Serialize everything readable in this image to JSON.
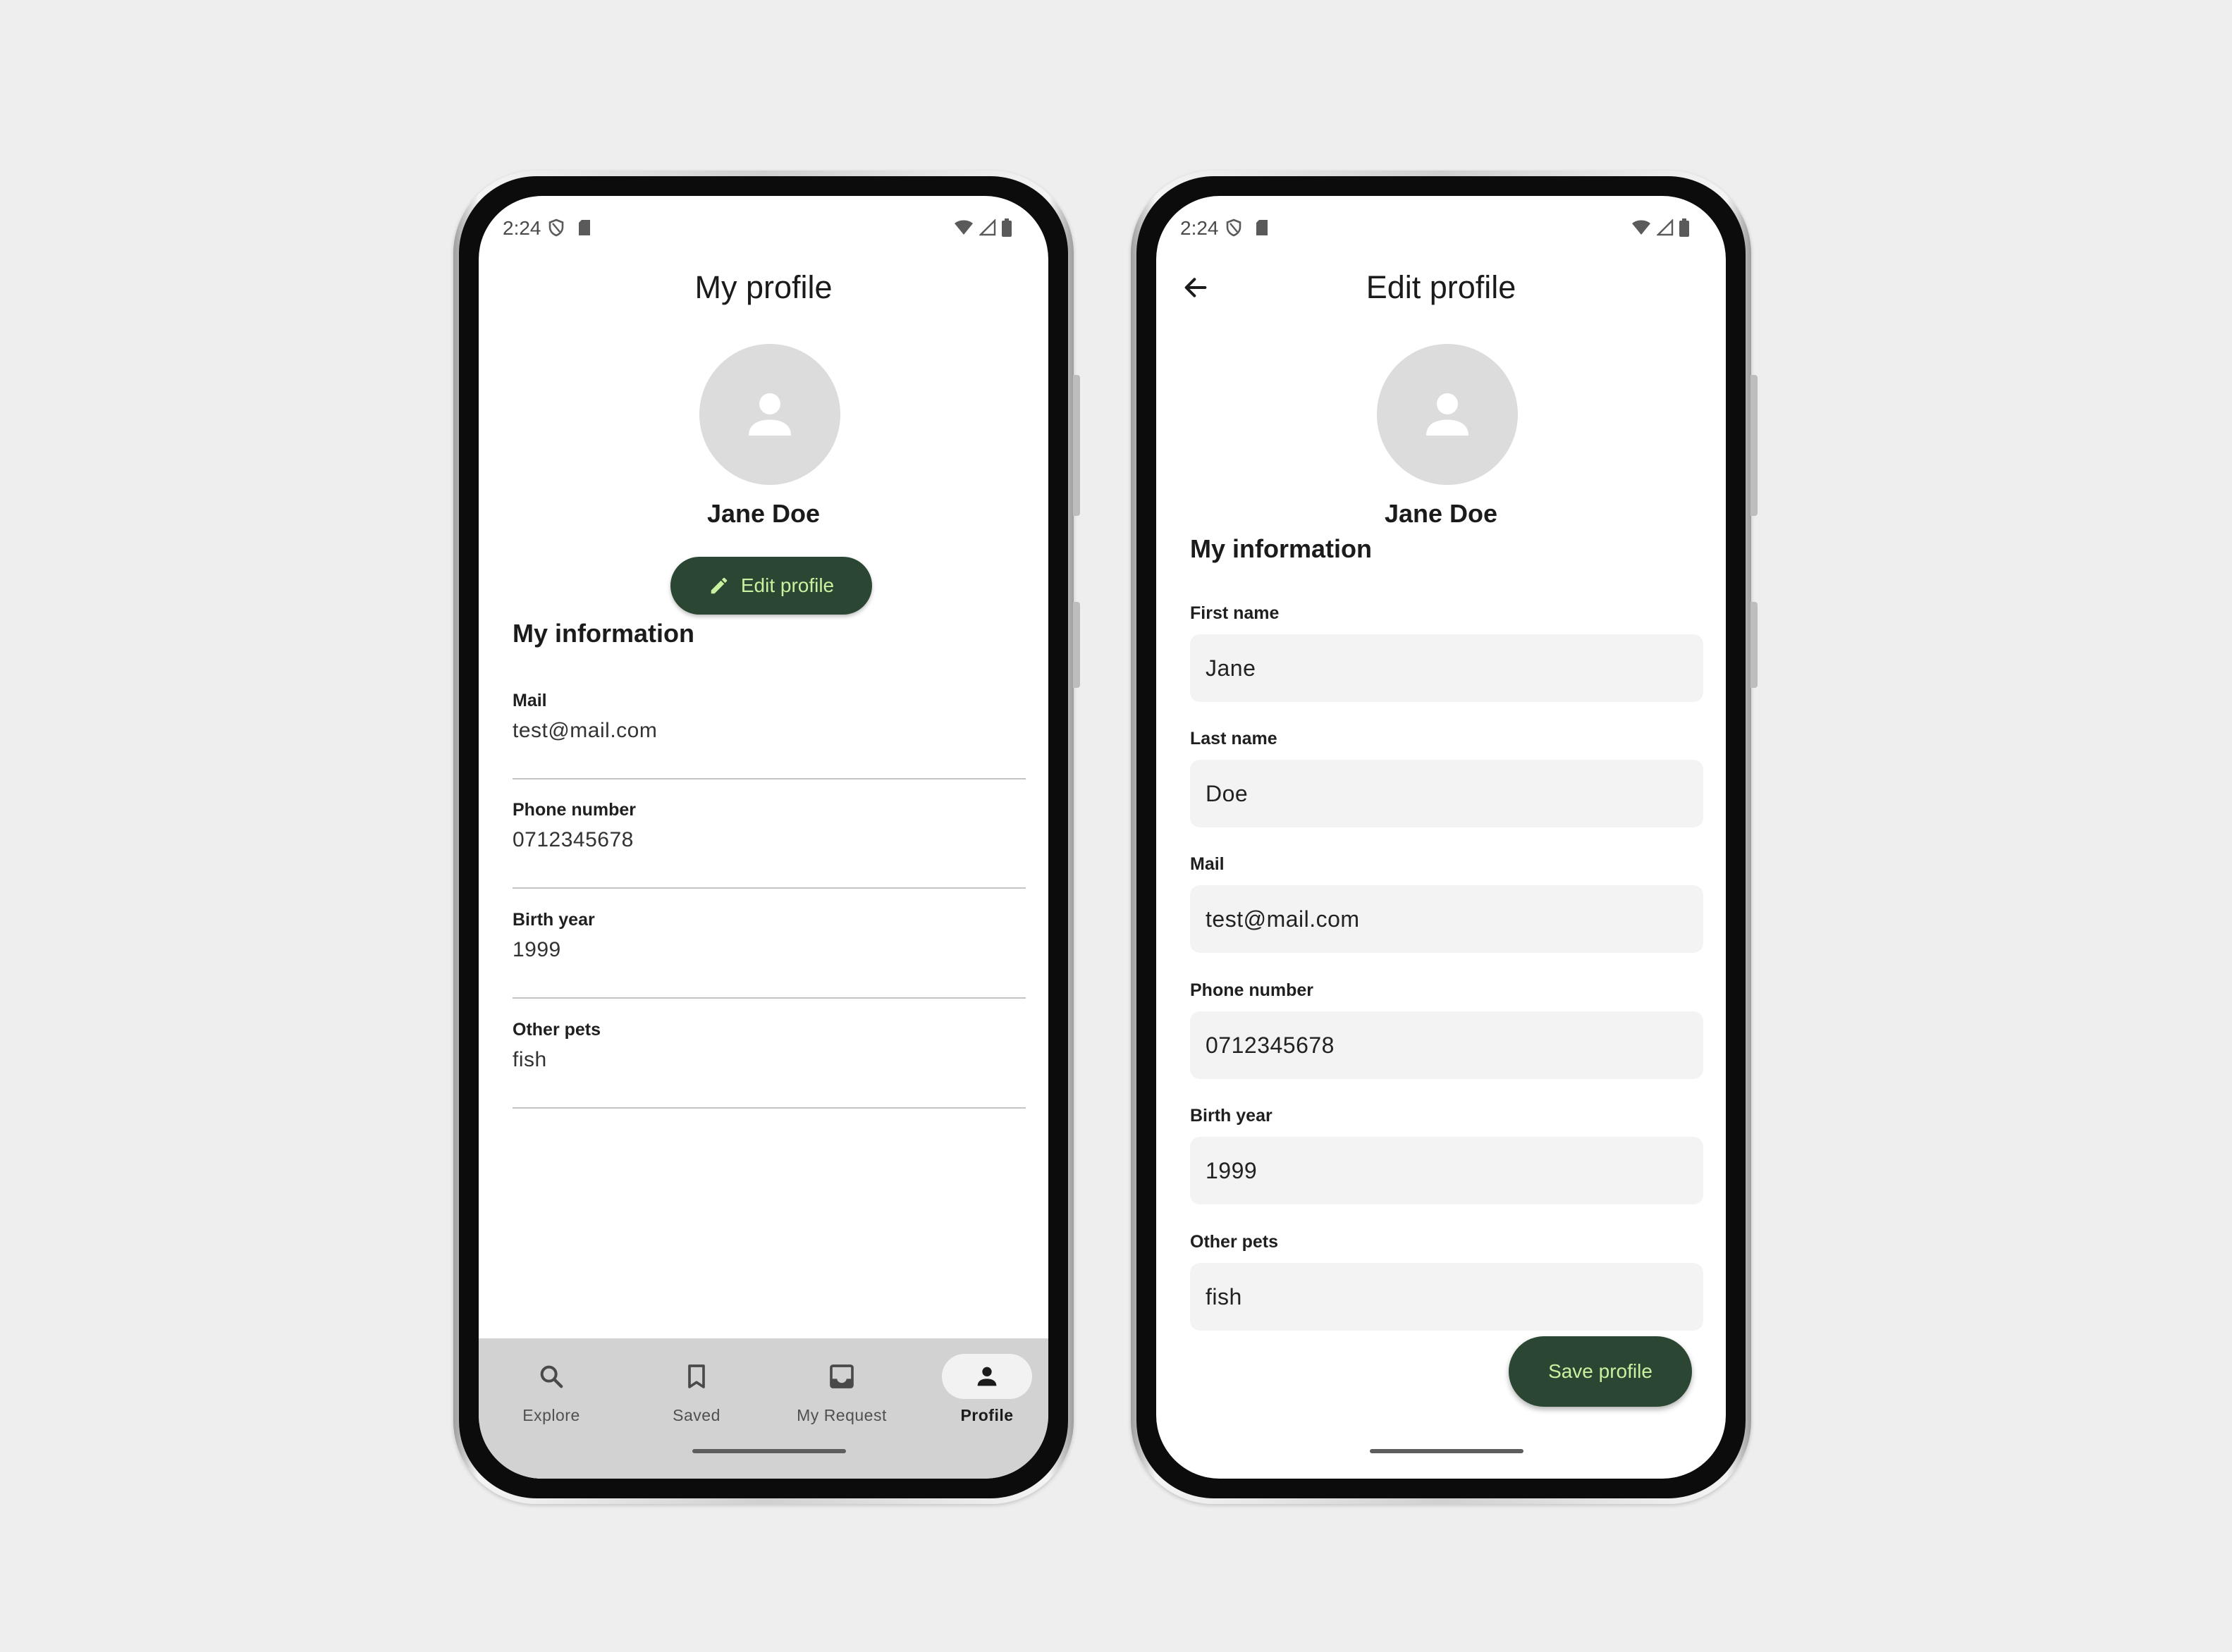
{
  "status_bar": {
    "time": "2:24"
  },
  "profile_screen": {
    "title": "My profile",
    "user_name": "Jane Doe",
    "edit_button": "Edit profile",
    "section_title": "My information",
    "info": [
      {
        "label": "Mail",
        "value": "test@mail.com"
      },
      {
        "label": "Phone number",
        "value": "0712345678"
      },
      {
        "label": "Birth year",
        "value": "1999"
      },
      {
        "label": "Other pets",
        "value": "fish"
      }
    ],
    "nav": [
      {
        "label": "Explore",
        "icon": "search-icon",
        "active": false
      },
      {
        "label": "Saved",
        "icon": "bookmark-icon",
        "active": false
      },
      {
        "label": "My Request",
        "icon": "inbox-icon",
        "active": false
      },
      {
        "label": "Profile",
        "icon": "person-icon",
        "active": true
      }
    ]
  },
  "edit_screen": {
    "title": "Edit profile",
    "user_name": "Jane Doe",
    "section_title": "My information",
    "fields": [
      {
        "label": "First name",
        "value": "Jane"
      },
      {
        "label": "Last name",
        "value": "Doe"
      },
      {
        "label": "Mail",
        "value": "test@mail.com"
      },
      {
        "label": "Phone number",
        "value": "0712345678"
      },
      {
        "label": "Birth year",
        "value": "1999"
      },
      {
        "label": "Other pets",
        "value": "fish"
      }
    ],
    "save_button": "Save profile"
  },
  "colors": {
    "primary_button": "#2b4733",
    "primary_button_text": "#c8f2a0",
    "nav_background": "#d2d2d2",
    "avatar_background": "#dcdcdc",
    "field_background": "#f3f3f3"
  }
}
